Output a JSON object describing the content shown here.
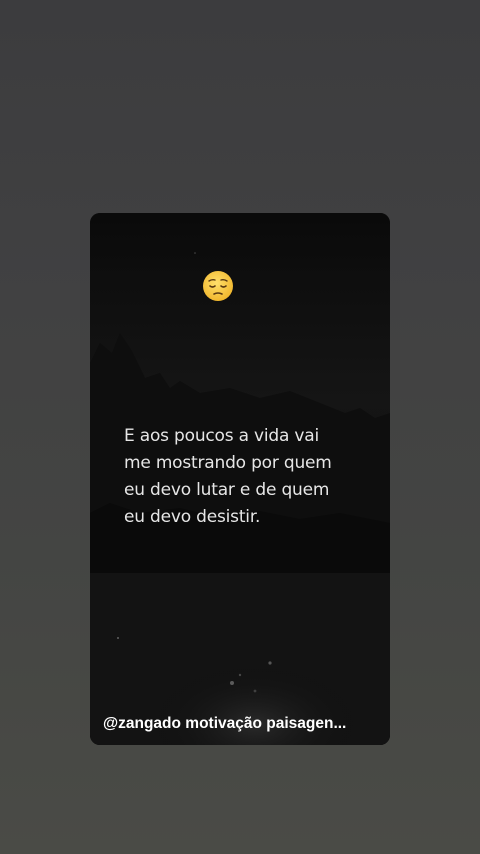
{
  "video": {
    "emoji": "pensive-face-icon",
    "quote_lines": [
      "E aos poucos a vida vai",
      "me mostrando por quem",
      "eu devo lutar e de quem",
      "eu devo desistir."
    ],
    "handle": "@zangado motivação paisagen..."
  },
  "colors": {
    "page_background": "#414142",
    "card_background": "#0c0c0c",
    "quote_text": "#e6e6e6",
    "handle_text": "#ffffff",
    "emoji_face": "#f7c948"
  }
}
